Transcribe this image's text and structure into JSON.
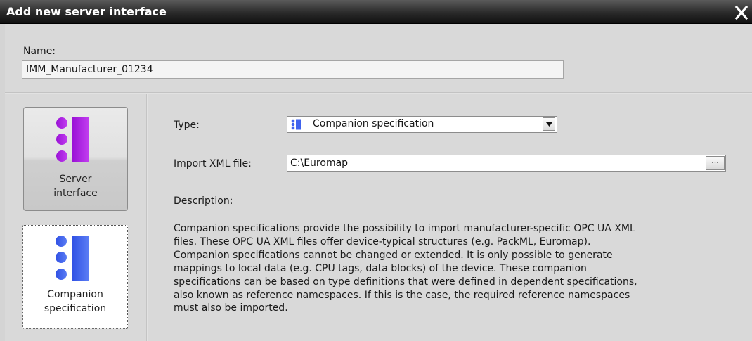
{
  "dialog": {
    "title": "Add new server interface",
    "close_glyph": "✕"
  },
  "name": {
    "label": "Name:",
    "value": "IMM_Manufacturer_01234"
  },
  "sidebar": {
    "items": [
      {
        "label_line1": "Server",
        "label_line2": "interface",
        "icon": "server-interface-icon",
        "color": "#b21fe0"
      },
      {
        "label_line1": "Companion",
        "label_line2": "specification",
        "icon": "companion-specification-icon",
        "color": "#3f63ee"
      }
    ]
  },
  "form": {
    "type_label": "Type:",
    "type_value": "Companion specification",
    "import_label": "Import XML file:",
    "import_value": "C:\\Euromap",
    "browse_label": "...",
    "description_label": "Description:",
    "description_lines": [
      "Companion specifications provide the possibility to import manufacturer-specific OPC UA XML",
      "files. These OPC UA XML files offer device-typical structures (e.g. PackML, Euromap).",
      "Companion specifications cannot be changed or extended. It is only possible to generate",
      "mappings to local data (e.g. CPU tags, data blocks) of the device. These companion",
      "specifications can be based on type definitions that were defined in dependent specifications,",
      "also known as reference namespaces. If this is the case, the required reference namespaces",
      "must also be imported."
    ]
  },
  "colors": {
    "server_purple": "#b21fe0",
    "companion_blue": "#3f63ee",
    "titlebar": "#2a2a2a"
  }
}
